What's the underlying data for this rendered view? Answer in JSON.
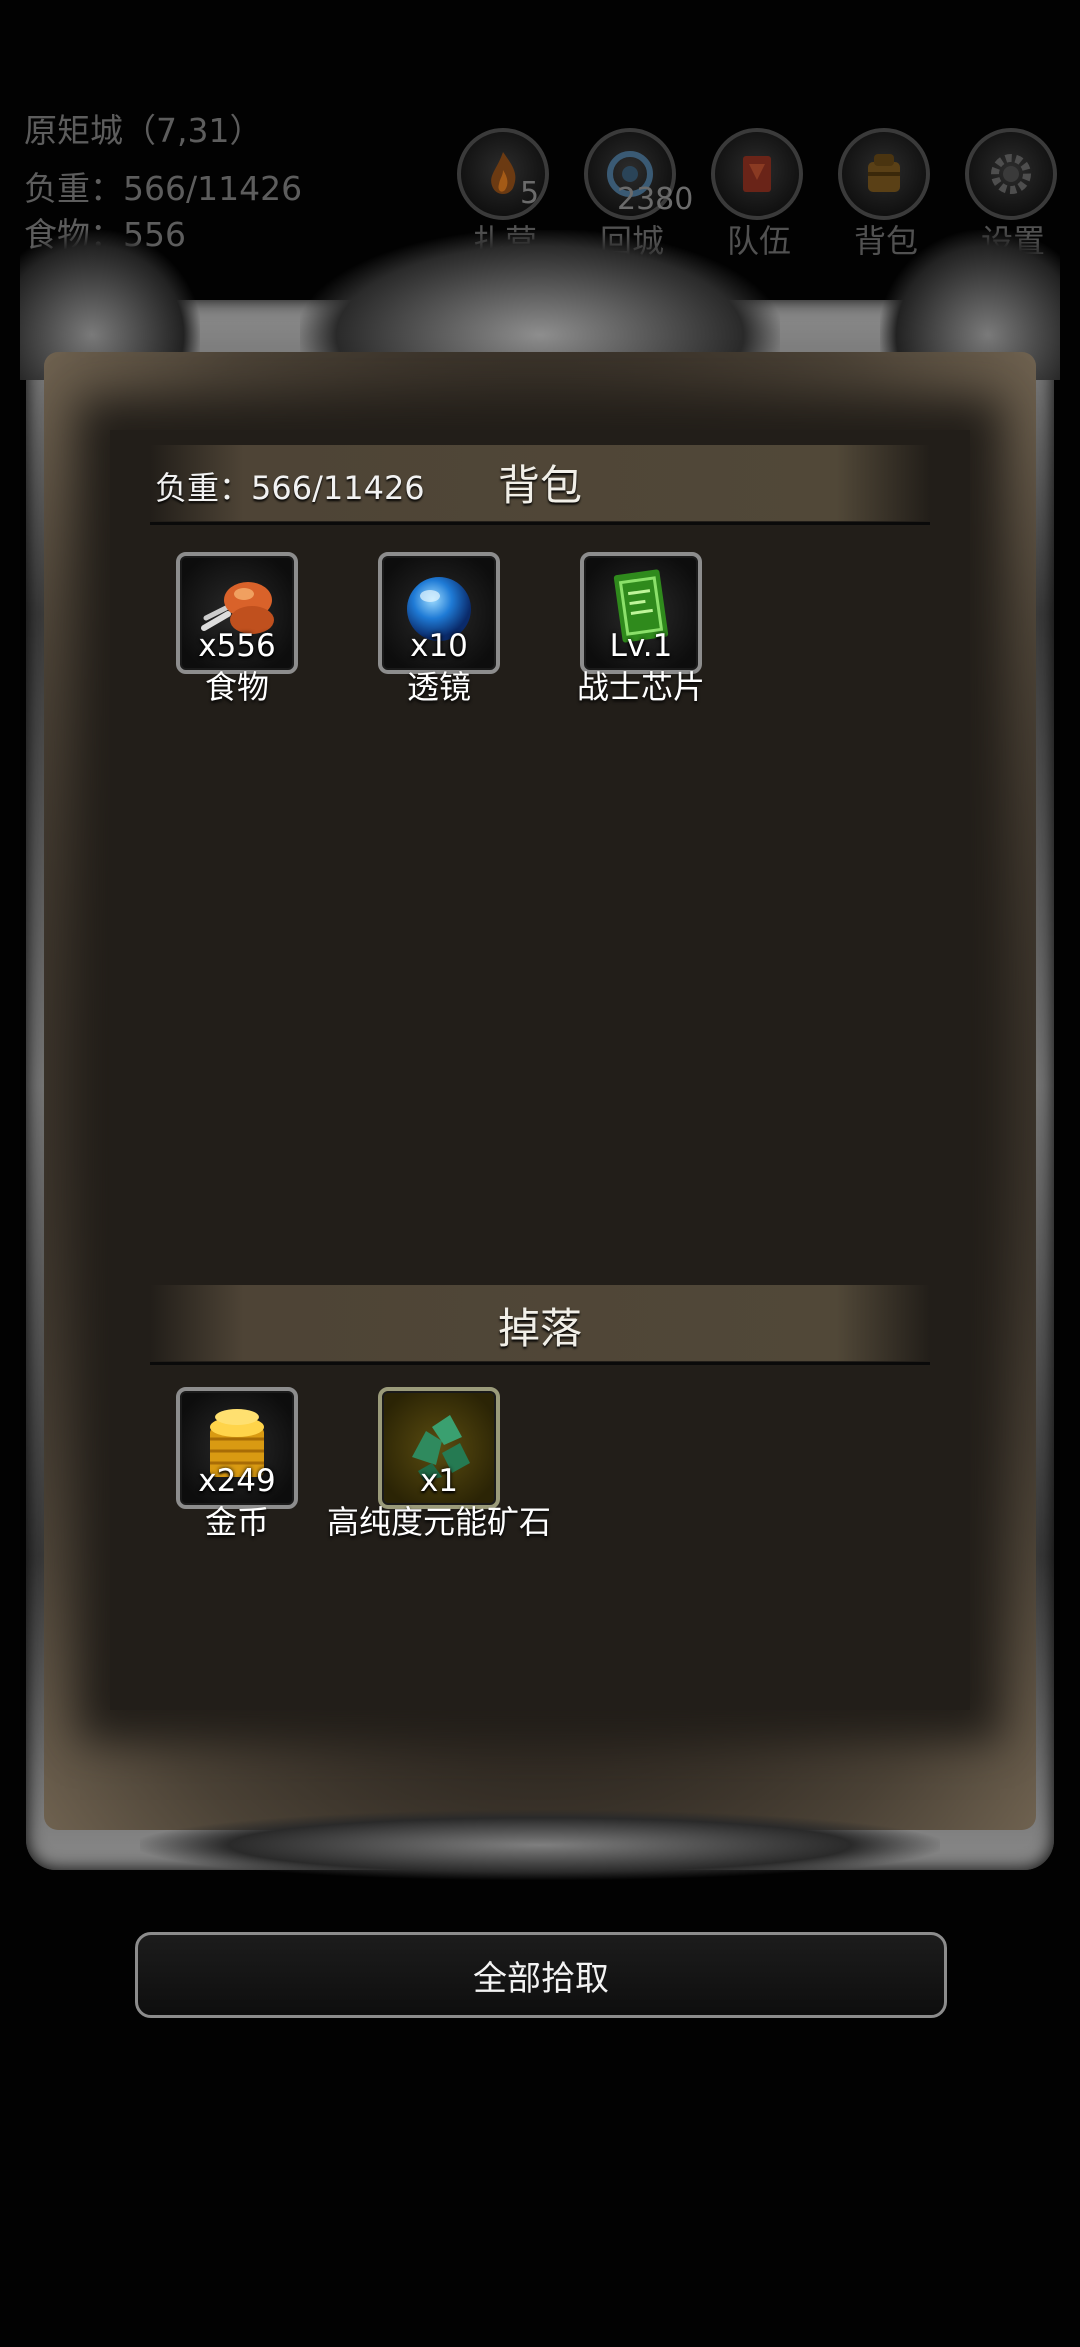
{
  "hud": {
    "location": "原矩城（7,31）",
    "load": "负重：566/11426",
    "food": "食物：556",
    "buttons": [
      {
        "label": "扎营",
        "count": "5",
        "icon": "campfire-icon"
      },
      {
        "label": "回城",
        "count": "2380",
        "icon": "portal-icon"
      },
      {
        "label": "队伍",
        "count": "",
        "icon": "team-banner-icon"
      },
      {
        "label": "背包",
        "count": "",
        "icon": "backpack-icon"
      },
      {
        "label": "设置",
        "count": "",
        "icon": "gear-icon"
      }
    ]
  },
  "backpack": {
    "title": "背包",
    "load_label": "负重：566/11426",
    "items": [
      {
        "qty": "x556",
        "name": "食物",
        "icon": "meat-icon"
      },
      {
        "qty": "x10",
        "name": "透镜",
        "icon": "lens-orb-icon"
      },
      {
        "qty": "Lv.1",
        "name": "战士芯片",
        "icon": "chip-icon"
      }
    ]
  },
  "drops": {
    "title": "掉落",
    "items": [
      {
        "qty": "x249",
        "name": "金币",
        "icon": "gold-coins-icon"
      },
      {
        "qty": "x1",
        "name": "高纯度元能矿石",
        "icon": "ore-icon"
      }
    ]
  },
  "actions": {
    "pick_all": "全部拾取"
  },
  "colors": {
    "background": "#020202",
    "panel_dark": "#221e19",
    "header_band": "#4e4436",
    "hud_text": "#5d5d5d"
  }
}
